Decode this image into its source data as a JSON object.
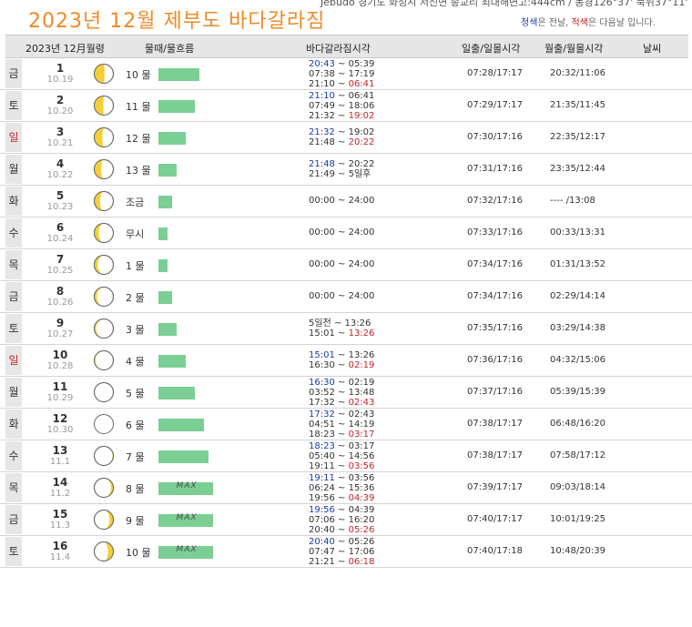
{
  "title": "2023년  12월  제부도  바다갈라짐",
  "top_info": "Jebudo 경기도 화성시 서신면 송교리 최대해면고:444cm / 동경126°37' 북위37°11'",
  "note": {
    "blue": "청색",
    "blue_rest": "은 전날, ",
    "red": "적색",
    "red_rest": "은 다음날 입니다."
  },
  "header": {
    "date": "2023년  12月월령",
    "water": "물때/물흐름",
    "parting": "바다갈라짐시각",
    "sun": "일출/일몰시각",
    "moon": "월출/월몰시각",
    "weather": "날씨"
  },
  "colors": {
    "bar": "#7ccf94",
    "prev_day": "#1a3aa8",
    "next_day": "#c0262c",
    "title": "#f08a24"
  },
  "rows": [
    {
      "dow": "금",
      "sunday": false,
      "day": "1",
      "lunar": "10.19",
      "phase": 0.73,
      "water": "10 물",
      "flow": 9,
      "max": false,
      "tides": [
        [
          {
            "t": "20:43",
            "c": "b"
          },
          {
            "t": "05:39",
            "c": ""
          }
        ],
        [
          {
            "t": "07:38",
            "c": ""
          },
          {
            "t": "17:19",
            "c": ""
          }
        ],
        [
          {
            "t": "21:10",
            "c": ""
          },
          {
            "t": "06:41",
            "c": "r"
          }
        ]
      ],
      "sun": "07:28/17:17",
      "moon": "20:32/11:06"
    },
    {
      "dow": "토",
      "sunday": false,
      "day": "2",
      "lunar": "10.20",
      "phase": 0.76,
      "water": "11 물",
      "flow": 8,
      "max": false,
      "tides": [
        [
          {
            "t": "21:10",
            "c": "b"
          },
          {
            "t": "06:41",
            "c": ""
          }
        ],
        [
          {
            "t": "07:49",
            "c": ""
          },
          {
            "t": "18:06",
            "c": ""
          }
        ],
        [
          {
            "t": "21:32",
            "c": ""
          },
          {
            "t": "19:02",
            "c": "r"
          }
        ]
      ],
      "sun": "07:29/17:17",
      "moon": "21:35/11:45"
    },
    {
      "dow": "일",
      "sunday": true,
      "day": "3",
      "lunar": "10.21",
      "phase": 0.79,
      "water": "12 물",
      "flow": 6,
      "max": false,
      "tides": [
        [
          {
            "t": "21:32",
            "c": "b"
          },
          {
            "t": "19:02",
            "c": ""
          }
        ],
        [
          {
            "t": "21:48",
            "c": ""
          },
          {
            "t": "20:22",
            "c": "r"
          }
        ]
      ],
      "sun": "07:30/17:16",
      "moon": "22:35/12:17"
    },
    {
      "dow": "월",
      "sunday": false,
      "day": "4",
      "lunar": "10.22",
      "phase": 0.82,
      "water": "13 물",
      "flow": 4,
      "max": false,
      "tides": [
        [
          {
            "t": "21:48",
            "c": "b"
          },
          {
            "t": "20:22",
            "c": ""
          }
        ],
        [
          {
            "t": "21:49",
            "c": ""
          },
          {
            "t": "5일후",
            "c": ""
          }
        ]
      ],
      "sun": "07:31/17:16",
      "moon": "23:35/12:44"
    },
    {
      "dow": "화",
      "sunday": false,
      "day": "5",
      "lunar": "10.23",
      "phase": 0.85,
      "water": "조금",
      "flow": 3,
      "max": false,
      "tides": [
        [
          {
            "t": "00:00",
            "c": ""
          },
          {
            "t": "24:00",
            "c": ""
          }
        ]
      ],
      "sun": "07:32/17:16",
      "moon": "---- /13:08"
    },
    {
      "dow": "수",
      "sunday": false,
      "day": "6",
      "lunar": "10.24",
      "phase": 0.88,
      "water": "무시",
      "flow": 2,
      "max": false,
      "tides": [
        [
          {
            "t": "00:00",
            "c": ""
          },
          {
            "t": "24:00",
            "c": ""
          }
        ]
      ],
      "sun": "07:33/17:16",
      "moon": "00:33/13:31"
    },
    {
      "dow": "목",
      "sunday": false,
      "day": "7",
      "lunar": "10.25",
      "phase": 0.91,
      "water": "1 물",
      "flow": 2,
      "max": false,
      "tides": [
        [
          {
            "t": "00:00",
            "c": ""
          },
          {
            "t": "24:00",
            "c": ""
          }
        ]
      ],
      "sun": "07:34/17:16",
      "moon": "01:31/13:52"
    },
    {
      "dow": "금",
      "sunday": false,
      "day": "8",
      "lunar": "10.26",
      "phase": 0.93,
      "water": "2 물",
      "flow": 3,
      "max": false,
      "tides": [
        [
          {
            "t": "00:00",
            "c": ""
          },
          {
            "t": "24:00",
            "c": ""
          }
        ]
      ],
      "sun": "07:34/17:16",
      "moon": "02:29/14:14"
    },
    {
      "dow": "토",
      "sunday": false,
      "day": "9",
      "lunar": "10.27",
      "phase": 0.95,
      "water": "3 물",
      "flow": 4,
      "max": false,
      "tides": [
        [
          {
            "t": "5일전",
            "c": ""
          },
          {
            "t": "13:26",
            "c": ""
          }
        ],
        [
          {
            "t": "15:01",
            "c": ""
          },
          {
            "t": "13:26",
            "c": "r"
          }
        ]
      ],
      "sun": "07:35/17:16",
      "moon": "03:29/14:38"
    },
    {
      "dow": "일",
      "sunday": true,
      "day": "10",
      "lunar": "10.28",
      "phase": 0.97,
      "water": "4 물",
      "flow": 6,
      "max": false,
      "tides": [
        [
          {
            "t": "15:01",
            "c": "b"
          },
          {
            "t": "13:26",
            "c": ""
          }
        ],
        [
          {
            "t": "16:30",
            "c": ""
          },
          {
            "t": "02:19",
            "c": "r"
          }
        ]
      ],
      "sun": "07:36/17:16",
      "moon": "04:32/15:06"
    },
    {
      "dow": "월",
      "sunday": false,
      "day": "11",
      "lunar": "10.29",
      "phase": 0.99,
      "water": "5 물",
      "flow": 8,
      "max": false,
      "tides": [
        [
          {
            "t": "16:30",
            "c": "b"
          },
          {
            "t": "02:19",
            "c": ""
          }
        ],
        [
          {
            "t": "03:52",
            "c": ""
          },
          {
            "t": "13:48",
            "c": ""
          }
        ],
        [
          {
            "t": "17:32",
            "c": ""
          },
          {
            "t": "02:43",
            "c": "r"
          }
        ]
      ],
      "sun": "07:37/17:16",
      "moon": "05:39/15:39"
    },
    {
      "dow": "화",
      "sunday": false,
      "day": "12",
      "lunar": "10.30",
      "phase": 1.0,
      "water": "6 물",
      "flow": 10,
      "max": false,
      "tides": [
        [
          {
            "t": "17:32",
            "c": "b"
          },
          {
            "t": "02:43",
            "c": ""
          }
        ],
        [
          {
            "t": "04:51",
            "c": ""
          },
          {
            "t": "14:19",
            "c": ""
          }
        ],
        [
          {
            "t": "18:23",
            "c": ""
          },
          {
            "t": "03:17",
            "c": "r"
          }
        ]
      ],
      "sun": "07:38/17:17",
      "moon": "06:48/16:20"
    },
    {
      "dow": "수",
      "sunday": false,
      "day": "13",
      "lunar": "11.1",
      "phase": 0.02,
      "water": "7 물",
      "flow": 11,
      "max": false,
      "tides": [
        [
          {
            "t": "18:23",
            "c": "b"
          },
          {
            "t": "03:17",
            "c": ""
          }
        ],
        [
          {
            "t": "05:40",
            "c": ""
          },
          {
            "t": "14:56",
            "c": ""
          }
        ],
        [
          {
            "t": "19:11",
            "c": ""
          },
          {
            "t": "03:56",
            "c": "r"
          }
        ]
      ],
      "sun": "07:38/17:17",
      "moon": "07:58/17:12"
    },
    {
      "dow": "목",
      "sunday": false,
      "day": "14",
      "lunar": "11.2",
      "phase": 0.06,
      "water": "8 물",
      "flow": 12,
      "max": true,
      "tides": [
        [
          {
            "t": "19:11",
            "c": "b"
          },
          {
            "t": "03:56",
            "c": ""
          }
        ],
        [
          {
            "t": "06:24",
            "c": ""
          },
          {
            "t": "15:36",
            "c": ""
          }
        ],
        [
          {
            "t": "19:56",
            "c": ""
          },
          {
            "t": "04:39",
            "c": "r"
          }
        ]
      ],
      "sun": "07:39/17:17",
      "moon": "09:03/18:14"
    },
    {
      "dow": "금",
      "sunday": false,
      "day": "15",
      "lunar": "11.3",
      "phase": 0.1,
      "water": "9 물",
      "flow": 12,
      "max": true,
      "tides": [
        [
          {
            "t": "19:56",
            "c": "b"
          },
          {
            "t": "04:39",
            "c": ""
          }
        ],
        [
          {
            "t": "07:06",
            "c": ""
          },
          {
            "t": "16:20",
            "c": ""
          }
        ],
        [
          {
            "t": "20:40",
            "c": ""
          },
          {
            "t": "05:26",
            "c": "r"
          }
        ]
      ],
      "sun": "07:40/17:17",
      "moon": "10:01/19:25"
    },
    {
      "dow": "토",
      "sunday": false,
      "day": "16",
      "lunar": "11.4",
      "phase": 0.14,
      "water": "10 물",
      "flow": 12,
      "max": true,
      "tides": [
        [
          {
            "t": "20:40",
            "c": "b"
          },
          {
            "t": "05:26",
            "c": ""
          }
        ],
        [
          {
            "t": "07:47",
            "c": ""
          },
          {
            "t": "17:06",
            "c": ""
          }
        ],
        [
          {
            "t": "21:21",
            "c": ""
          },
          {
            "t": "06:18",
            "c": "r"
          }
        ]
      ],
      "sun": "07:40/17:18",
      "moon": "10:48/20:39"
    }
  ],
  "max_label": "MAX"
}
